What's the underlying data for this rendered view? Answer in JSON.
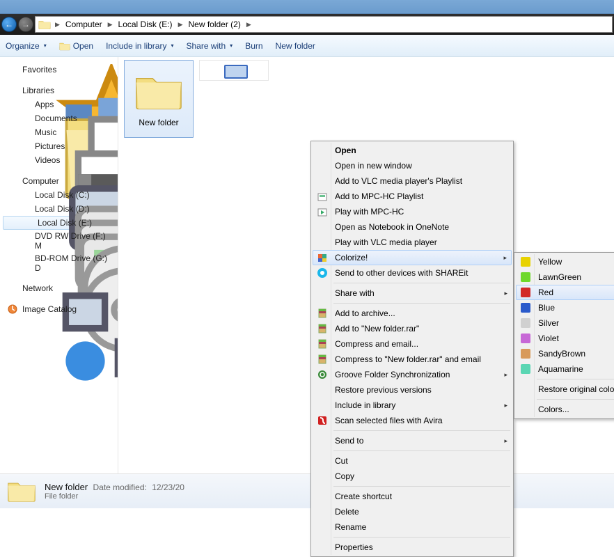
{
  "breadcrumb": {
    "items": [
      "Computer",
      "Local Disk (E:)",
      "New folder (2)"
    ]
  },
  "toolbar": {
    "organize": "Organize",
    "open": "Open",
    "include": "Include in library",
    "share": "Share with",
    "burn": "Burn",
    "newfolder": "New folder"
  },
  "sidebar": {
    "favorites": "Favorites",
    "libraries": "Libraries",
    "apps": "Apps",
    "documents": "Documents",
    "music": "Music",
    "pictures": "Pictures",
    "videos": "Videos",
    "computer": "Computer",
    "ldc": "Local Disk (C:)",
    "ldd": "Local Disk (D:)",
    "lde": "Local Disk (E:)",
    "dvd": "DVD RW Drive (F:)  M",
    "bdrom": "BD-ROM Drive (G:) D",
    "network": "Network",
    "imagecatalog": "Image Catalog"
  },
  "item": {
    "name": "New folder"
  },
  "context": {
    "open": "Open",
    "open_new": "Open in new window",
    "vlc_playlist": "Add to VLC media player's Playlist",
    "mpc_playlist": "Add to MPC-HC Playlist",
    "mpc_play": "Play with MPC-HC",
    "onenote": "Open as Notebook in OneNote",
    "vlc_play": "Play with VLC media player",
    "colorize": "Colorize!",
    "shareit": "Send to other devices with SHAREit",
    "sharewith": "Share with",
    "archive_add": "Add to archive...",
    "archive_rar": "Add to \"New folder.rar\"",
    "compress_email": "Compress and email...",
    "compress_rar_email": "Compress to \"New folder.rar\" and email",
    "groove": "Groove Folder Synchronization",
    "restore_prev": "Restore previous versions",
    "include_lib": "Include in library",
    "avira": "Scan selected files with Avira",
    "sendto": "Send to",
    "cut": "Cut",
    "copy": "Copy",
    "shortcut": "Create shortcut",
    "delete": "Delete",
    "rename": "Rename",
    "properties": "Properties"
  },
  "colors": {
    "yellow": {
      "label": "Yellow",
      "hex": "#e8d200"
    },
    "lawngreen": {
      "label": "LawnGreen",
      "hex": "#6fd82b"
    },
    "red": {
      "label": "Red",
      "hex": "#d22828"
    },
    "blue": {
      "label": "Blue",
      "hex": "#2a5acb"
    },
    "silver": {
      "label": "Silver",
      "hex": "#d0d0d0"
    },
    "violet": {
      "label": "Violet",
      "hex": "#c768d6"
    },
    "sandybrown": {
      "label": "SandyBrown",
      "hex": "#d89a5a"
    },
    "aquamarine": {
      "label": "Aquamarine",
      "hex": "#5ad6b3"
    },
    "restore": "Restore original color",
    "colors": "Colors..."
  },
  "status": {
    "name": "New folder",
    "modified_label": "Date modified:",
    "modified_value": "12/23/20",
    "type": "File folder"
  }
}
